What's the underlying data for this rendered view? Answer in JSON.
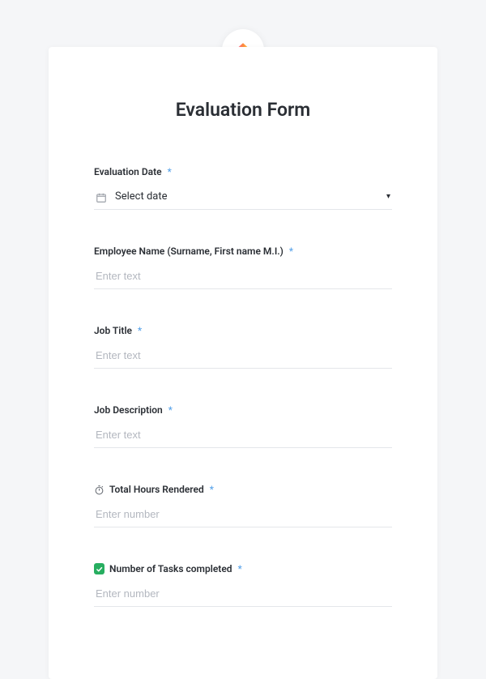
{
  "form": {
    "title": "Evaluation Form",
    "fields": {
      "evaluation_date": {
        "label": "Evaluation Date",
        "placeholder": "Select date"
      },
      "employee_name": {
        "label": "Employee Name (Surname, First name M.I.)",
        "placeholder": "Enter text"
      },
      "job_title": {
        "label": "Job Title",
        "placeholder": "Enter text"
      },
      "job_description": {
        "label": "Job Description",
        "placeholder": "Enter text"
      },
      "total_hours": {
        "label": "Total Hours Rendered",
        "placeholder": "Enter number"
      },
      "tasks_completed": {
        "label": "Number of Tasks completed",
        "placeholder": "Enter number"
      }
    },
    "required_marker": "*"
  }
}
